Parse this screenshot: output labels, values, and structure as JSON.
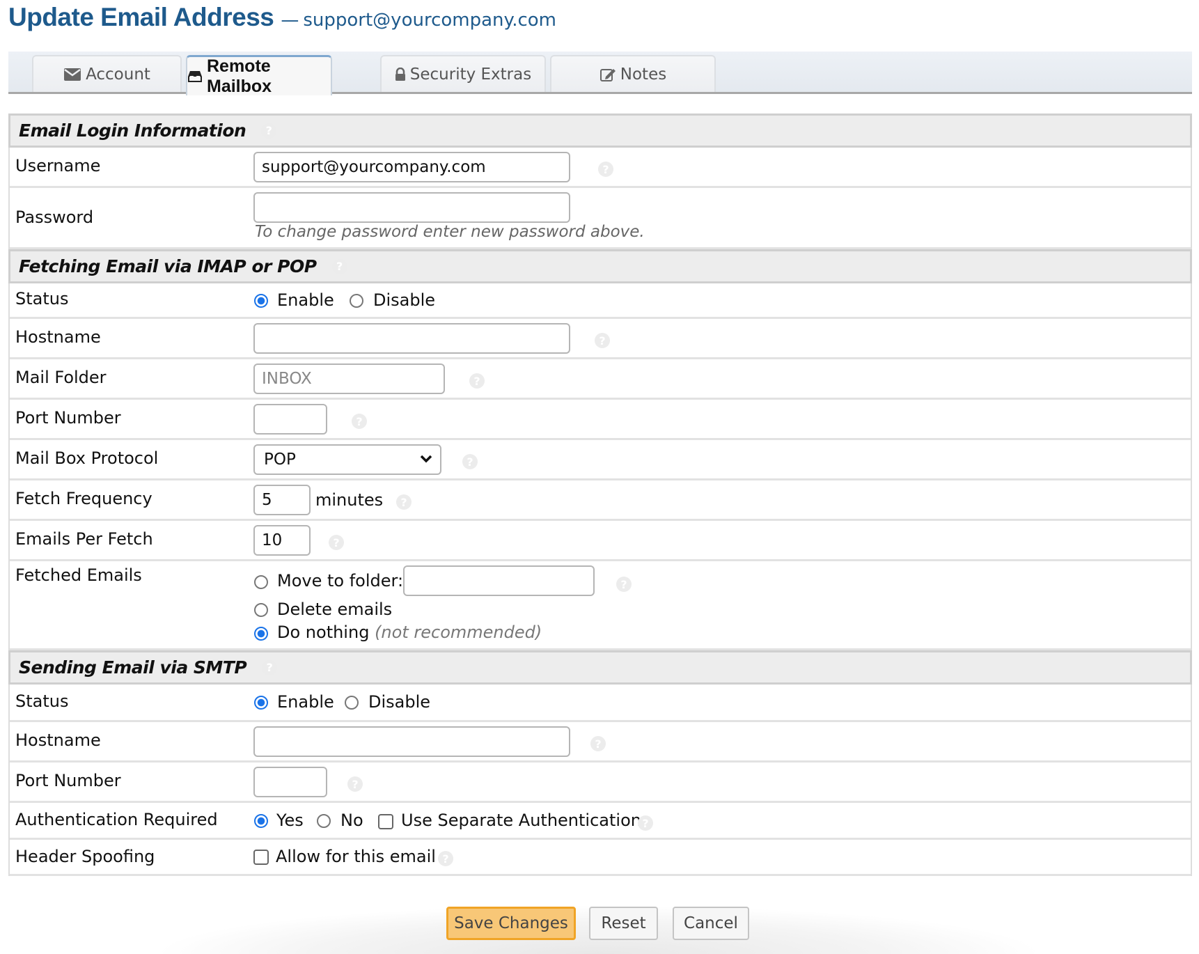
{
  "header": {
    "title": "Update Email Address",
    "separator": "—",
    "email": "support@yourcompany.com"
  },
  "tabs": [
    {
      "label": "Account",
      "icon": "envelope-icon",
      "active": false
    },
    {
      "label": "Remote Mailbox",
      "icon": "inbox-icon",
      "active": true
    },
    {
      "label": "Security Extras",
      "icon": "lock-icon",
      "active": false
    },
    {
      "label": "Notes",
      "icon": "edit-icon",
      "active": false
    }
  ],
  "login": {
    "heading": "Email Login Information",
    "username_label": "Username",
    "username_value": "support@yourcompany.com",
    "password_label": "Password",
    "password_value": "",
    "password_hint": "To change password enter new password above."
  },
  "fetching": {
    "heading": "Fetching Email via IMAP or POP",
    "status_label": "Status",
    "status_options": [
      "Enable",
      "Disable"
    ],
    "status_selected": "Enable",
    "hostname_label": "Hostname",
    "hostname_value": "",
    "folder_label": "Mail Folder",
    "folder_placeholder": "INBOX",
    "port_label": "Port Number",
    "port_value": "",
    "protocol_label": "Mail Box Protocol",
    "protocol_selected": "POP",
    "frequency_label": "Fetch Frequency",
    "frequency_value": "5",
    "frequency_unit": "minutes",
    "per_fetch_label": "Emails Per Fetch",
    "per_fetch_value": "10",
    "fetched_label": "Fetched Emails",
    "fetched_options": {
      "move": "Move to folder:",
      "delete": "Delete emails",
      "nothing": "Do nothing",
      "nothing_note": "(not recommended)"
    },
    "fetched_selected": "Do nothing",
    "move_folder_value": ""
  },
  "sending": {
    "heading": "Sending Email via SMTP",
    "status_label": "Status",
    "status_options": [
      "Enable",
      "Disable"
    ],
    "status_selected": "Enable",
    "hostname_label": "Hostname",
    "hostname_value": "",
    "port_label": "Port Number",
    "port_value": "",
    "auth_label": "Authentication Required",
    "auth_options": [
      "Yes",
      "No"
    ],
    "auth_selected": "Yes",
    "separate_auth_label": "Use Separate Authentication",
    "separate_auth_checked": false,
    "spoof_label": "Header Spoofing",
    "spoof_option": "Allow for this email",
    "spoof_checked": false
  },
  "help_glyph": "?",
  "buttons": {
    "save": "Save Changes",
    "reset": "Reset",
    "cancel": "Cancel"
  },
  "colors": {
    "title": "#1e5a8c",
    "radio": "#1a73e8",
    "save_bg": "#f8c777",
    "save_border": "#f0a426"
  }
}
